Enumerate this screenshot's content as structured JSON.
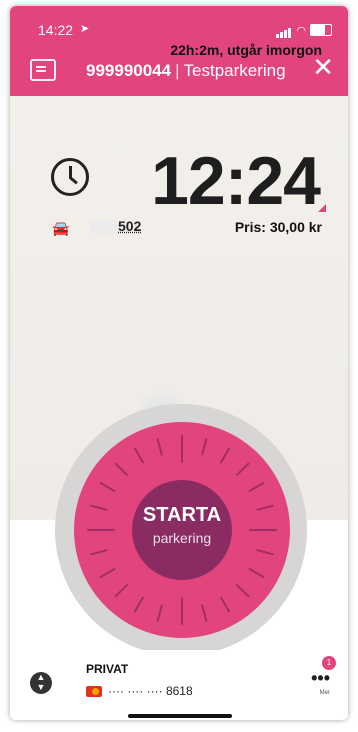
{
  "status": {
    "time": "14:22"
  },
  "header": {
    "parking_id": "999990044",
    "zone": "Testparkering"
  },
  "timer": {
    "remaining": "22h:2m, utgår imorgon",
    "end_time": "12:24"
  },
  "vehicle": {
    "plate_suffix": "502"
  },
  "price": "Pris: 30,00 kr",
  "dial": {
    "label": "STARTA",
    "sublabel": "parkering"
  },
  "footer": {
    "account": "PRIVAT",
    "card_number": "···· ···· ···· 8618",
    "more_label": "Mer",
    "badge_count": "1"
  },
  "colors": {
    "brand": "#e2457e",
    "dial_center": "#8a2b61"
  }
}
